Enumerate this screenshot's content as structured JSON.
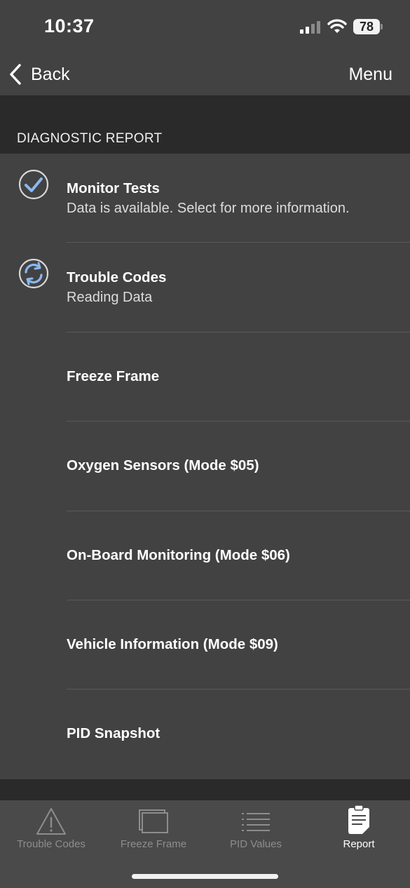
{
  "status": {
    "time": "10:37",
    "battery": "78"
  },
  "nav": {
    "back_label": "Back",
    "menu_label": "Menu"
  },
  "section": {
    "title": "DIAGNOSTIC REPORT"
  },
  "items": [
    {
      "title": "Monitor Tests",
      "subtitle": "Data is available. Select for more information.",
      "icon": "checkmark-circle-icon"
    },
    {
      "title": "Trouble Codes",
      "subtitle": "Reading Data",
      "icon": "refresh-circle-icon"
    },
    {
      "title": "Freeze Frame",
      "subtitle": ""
    },
    {
      "title": "Oxygen Sensors (Mode $05)",
      "subtitle": ""
    },
    {
      "title": "On-Board Monitoring (Mode $06)",
      "subtitle": ""
    },
    {
      "title": "Vehicle Information (Mode $09)",
      "subtitle": ""
    },
    {
      "title": "PID Snapshot",
      "subtitle": ""
    }
  ],
  "tabs": [
    {
      "label": "Trouble Codes",
      "icon": "warning-triangle-icon",
      "active": false
    },
    {
      "label": "Freeze Frame",
      "icon": "stacked-frames-icon",
      "active": false
    },
    {
      "label": "PID Values",
      "icon": "list-lines-icon",
      "active": false
    },
    {
      "label": "Report",
      "icon": "clipboard-report-icon",
      "active": true
    }
  ],
  "colors": {
    "background": "#424242",
    "section_band": "#2a2a2a",
    "tab_bar": "#4a4a4a",
    "accent_blue": "#8ab8f0",
    "inactive_tab": "#8d8d8d"
  }
}
